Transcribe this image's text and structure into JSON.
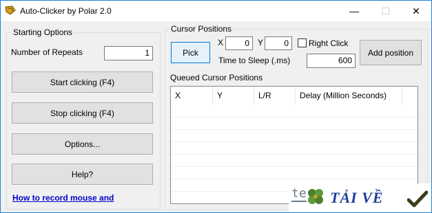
{
  "window": {
    "title": "Auto-Clicker by Polar 2.0",
    "minimize_glyph": "—",
    "maximize_glyph": "☐",
    "close_glyph": "✕"
  },
  "starting_options": {
    "group_title": "Starting Options",
    "repeats_label": "Number of Repeats",
    "repeats_value": "1",
    "start_button": "Start clicking (F4)",
    "stop_button": "Stop clicking (F4)",
    "options_button": "Options...",
    "help_button": "Help?",
    "record_link": "How to record mouse and"
  },
  "cursor_positions": {
    "group_title": "Cursor Positions",
    "pick_button": "Pick",
    "x_label": "X",
    "x_value": "0",
    "y_label": "Y",
    "y_value": "0",
    "right_click_label": "Right Click",
    "right_click_checked": false,
    "sleep_label": "Time to Sleep (.ms)",
    "sleep_value": "600",
    "add_position_button": "Add position"
  },
  "queue": {
    "title": "Queued Cursor Positions",
    "columns": [
      "X",
      "Y",
      "L/R",
      "Delay (Million Seconds)"
    ]
  },
  "watermark": {
    "brand_left": "te",
    "brand_text": "TẢI VỀ",
    "clover_icon": "clover-icon",
    "check_icon": "checkmark-icon"
  }
}
